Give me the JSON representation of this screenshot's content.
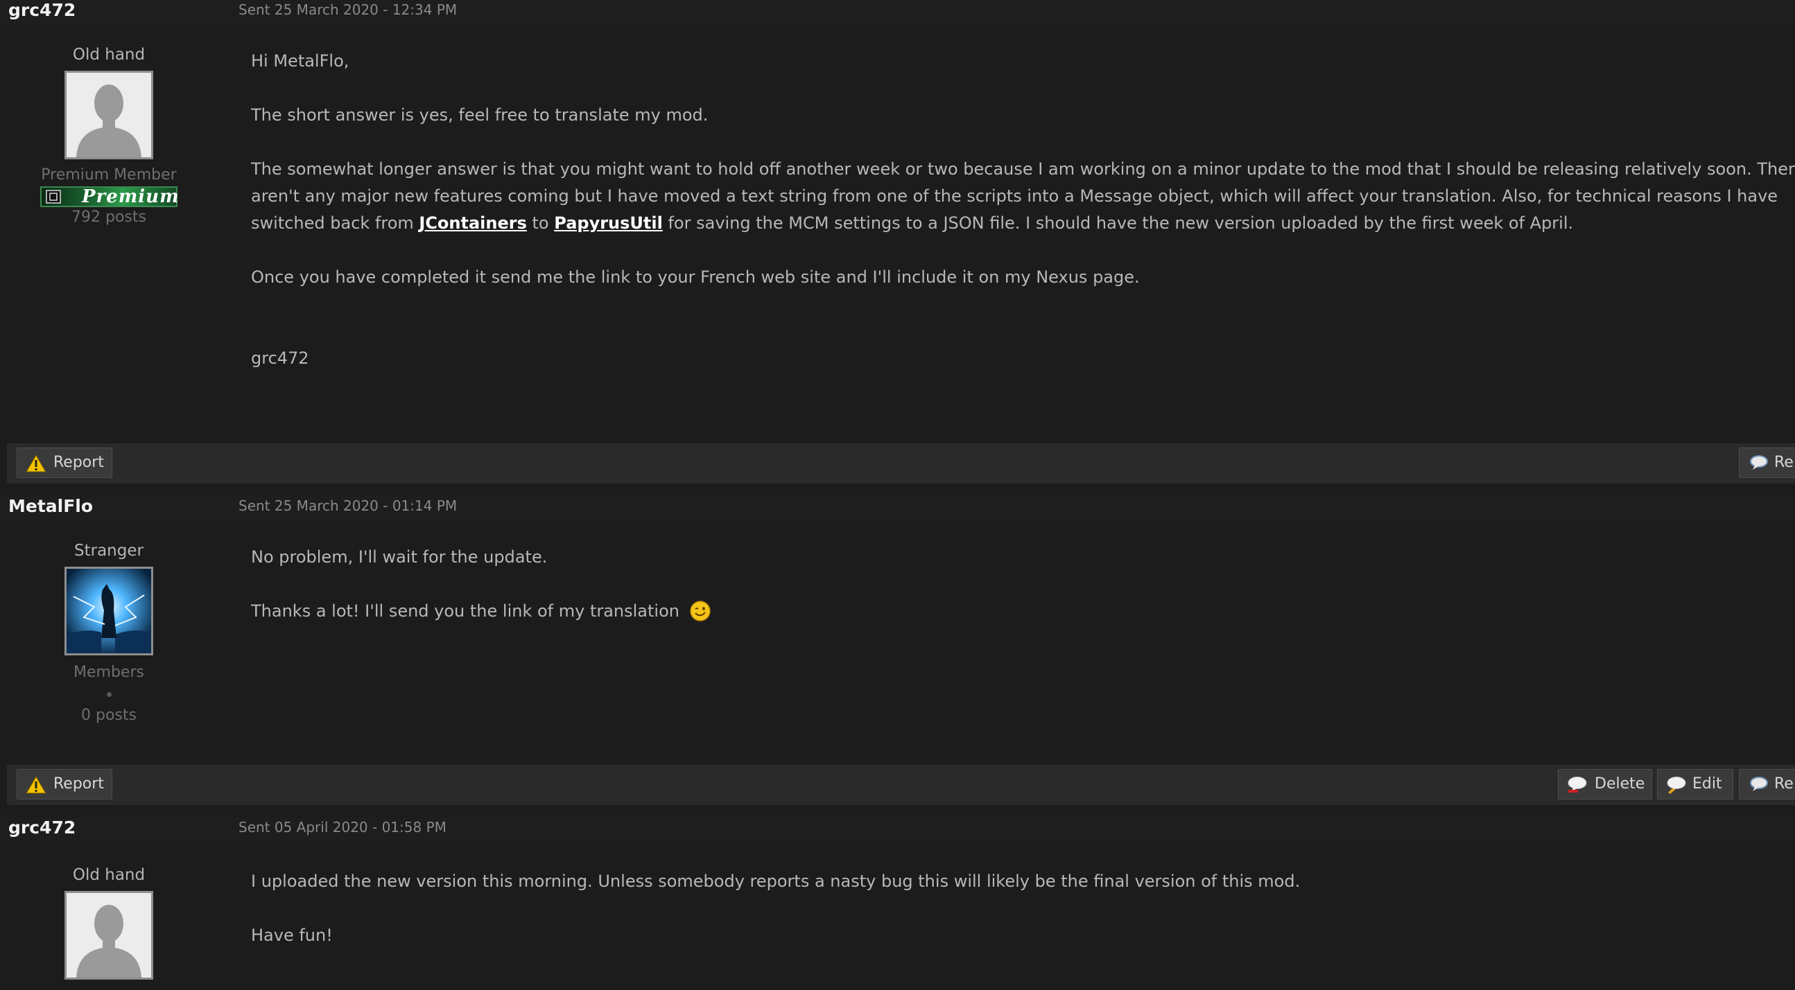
{
  "posts": [
    {
      "author": "grc472",
      "date": "Sent 25 March 2020 - 12:34 PM",
      "rank": "Old hand",
      "group": "Premium Member",
      "badge": "Premium",
      "post_count": "792 posts",
      "greeting": "Hi MetalFlo,",
      "p2": "The short answer is yes, feel free to translate my mod.",
      "p3_line1": "The somewhat longer answer is that you might want to hold off another week or two because I am working on a minor update to the mod that I should be releasing relatively soon.  There",
      "p3_line2": "aren't any major new features coming but I have moved a text string from one of the scripts into a Message object, which will affect your translation.  Also, for technical reasons I have",
      "p3_line3_pre": "switched back from ",
      "link1": "JContainers",
      "p3_line3_mid": " to ",
      "link2": "PapyrusUtil",
      "p3_line3_post": " for saving the MCM settings to a JSON file.  I should have the new version uploaded by the first week of April.",
      "p4": "Once you have completed it send me the link to your French web site and I'll include it on my Nexus page.",
      "signature": "grc472",
      "report_label": "Report",
      "reply_label": "Re"
    },
    {
      "author": "MetalFlo",
      "date": "Sent 25 March 2020 - 01:14 PM",
      "rank": "Stranger",
      "group": "Members",
      "post_count": "0 posts",
      "p1": "No problem, I'll wait for the update.",
      "p2": "Thanks a lot! I'll send you the link of my translation",
      "report_label": "Report",
      "delete_label": "Delete",
      "edit_label": "Edit",
      "reply_label": "Re"
    },
    {
      "author": "grc472",
      "date": "Sent 05 April 2020 - 01:58 PM",
      "rank": "Old hand",
      "p1": "I uploaded the new version this morning.  Unless somebody reports a nasty bug this will likely be the final version of this mod.",
      "p2": "Have fun!"
    }
  ],
  "colors": {
    "background": "#1c1c1c",
    "action_bar": "#2a2a2a",
    "button": "#3a3a3a",
    "premium_green": "#2c9a4a"
  },
  "icons": {
    "report": "warning-triangle-icon",
    "reply": "speech-bubble-icon",
    "delete": "speech-bubble-delete-icon",
    "edit": "speech-bubble-edit-icon",
    "emoji": "wink-smiley-icon",
    "default_avatar": "user-silhouette-icon"
  }
}
